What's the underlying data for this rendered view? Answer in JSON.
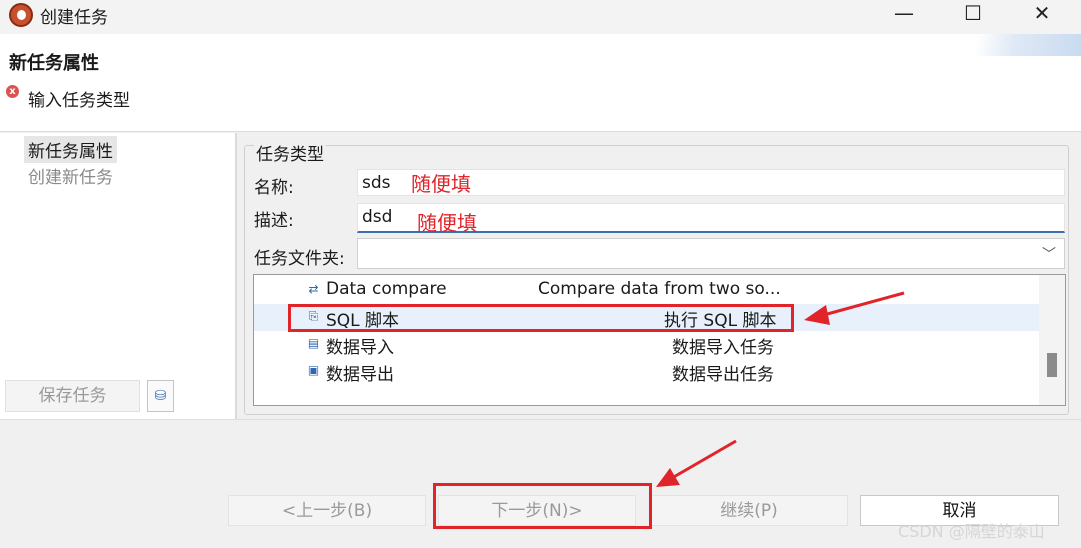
{
  "window": {
    "title": "创建任务",
    "minimize": "—",
    "maximize": "☐",
    "close": "✕"
  },
  "header": {
    "title": "新任务属性",
    "message": "输入任务类型",
    "error_icon": "x"
  },
  "nav": {
    "items": [
      {
        "label": "新任务属性"
      },
      {
        "label": "创建新任务"
      }
    ]
  },
  "left_buttons": {
    "save": "保存任务",
    "small_icon": "⛁"
  },
  "form": {
    "group_title": "任务类型",
    "name_label": "名称:",
    "name_value": "sds",
    "desc_label": "描述:",
    "desc_value": "dsd",
    "folder_label": "任务文件夹:",
    "folder_value": "",
    "note1": "随便填",
    "note2": "随便填"
  },
  "task_list": [
    {
      "icon": "compare-icon",
      "glyph": "⇄",
      "name": "Data compare",
      "desc": "Compare data from two so..."
    },
    {
      "icon": "sql-script-icon",
      "glyph": "⎘",
      "name": "SQL 脚本",
      "desc": "执行 SQL 脚本",
      "selected": true
    },
    {
      "icon": "data-import-icon",
      "glyph": "▤",
      "name": "数据导入",
      "desc": "数据导入任务"
    },
    {
      "icon": "data-export-icon",
      "glyph": "▣",
      "name": "数据导出",
      "desc": "数据导出任务"
    }
  ],
  "buttons": {
    "back": "<上一步(B)",
    "next": "下一步(N)>",
    "continue": "继续(P)",
    "cancel": "取消"
  },
  "watermark": "CSDN @隔壁的泰山",
  "colors": {
    "annotation_red": "#e0242a",
    "selection": "#e8f1fb"
  }
}
